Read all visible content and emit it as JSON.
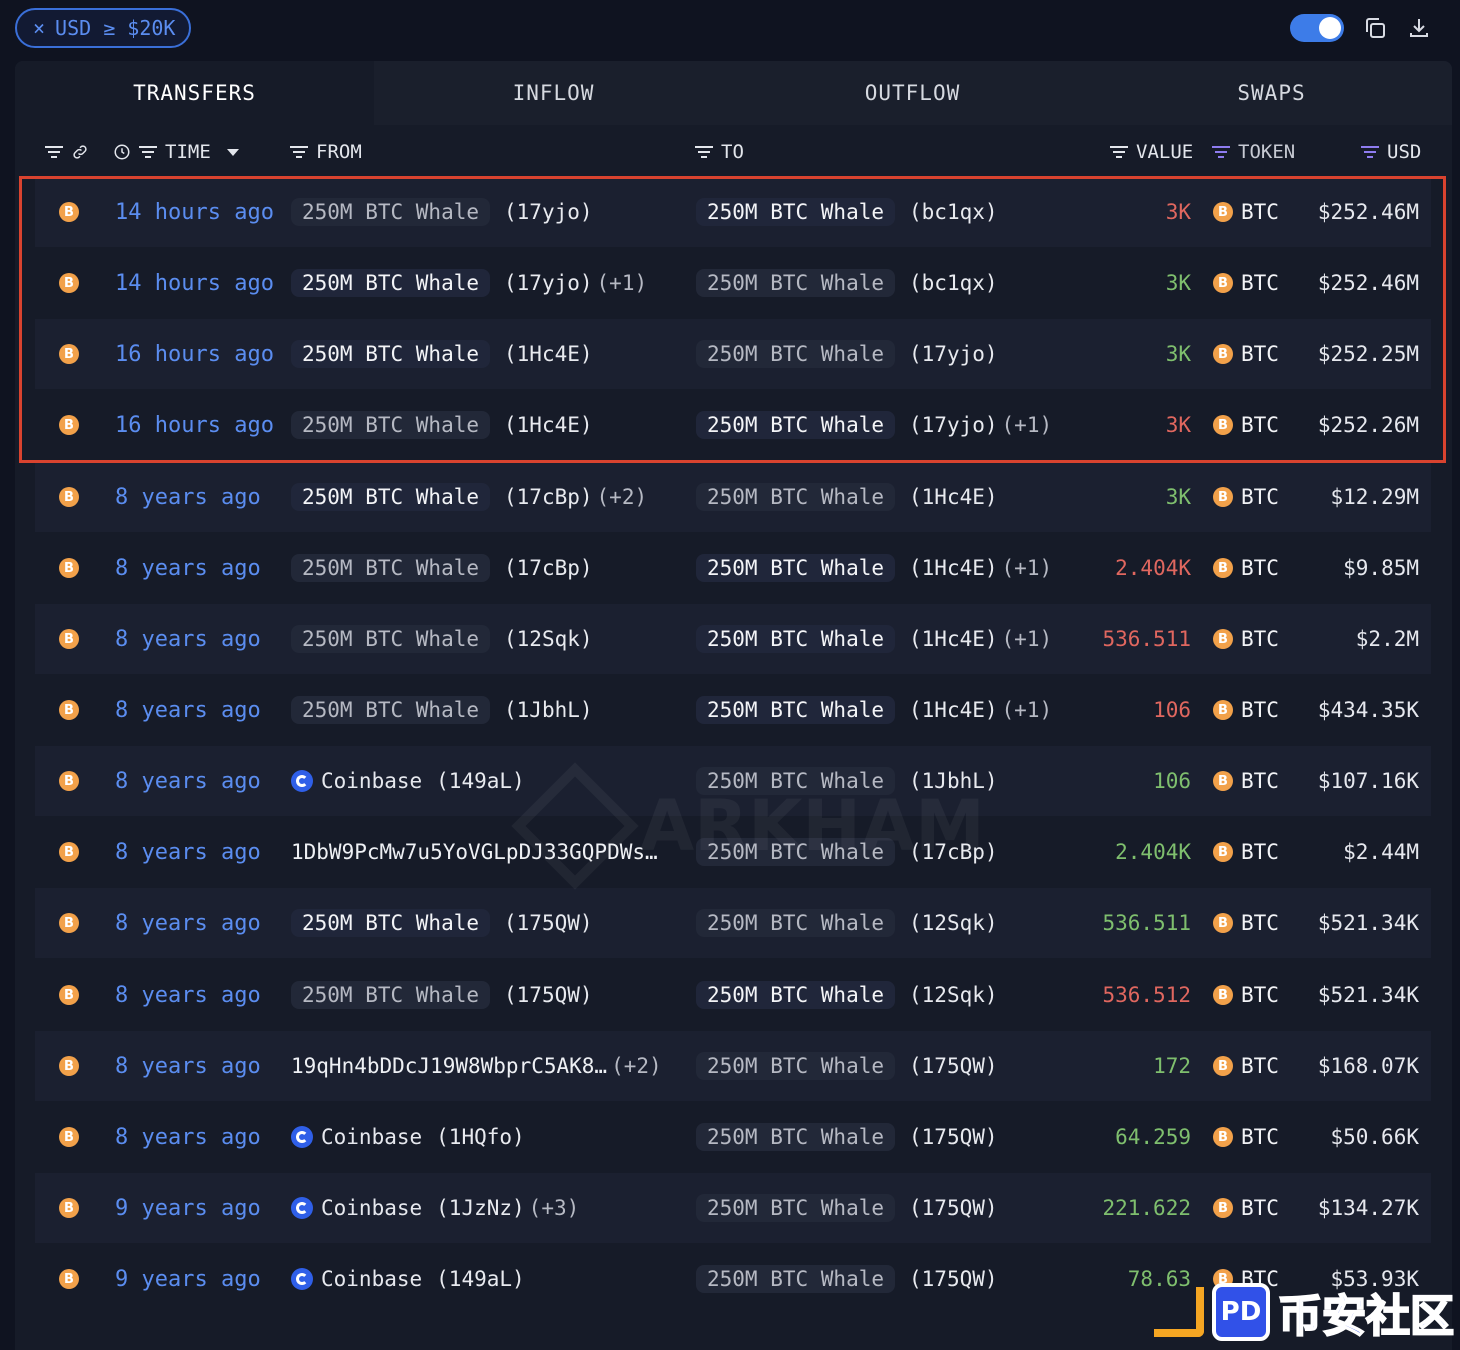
{
  "filter": {
    "close": "×",
    "label": "USD ≥ $20K"
  },
  "tabs": [
    "TRANSFERS",
    "INFLOW",
    "OUTFLOW",
    "SWAPS"
  ],
  "columns": {
    "time": "TIME",
    "from": "FROM",
    "to": "TO",
    "value": "VALUE",
    "token": "TOKEN",
    "usd": "USD"
  },
  "coin_glyph": "B",
  "rows": [
    {
      "time": "14 hours ago",
      "from": {
        "type": "entity",
        "name": "250M BTC Whale",
        "addr": "(17yjo)",
        "extra": "",
        "dim": true
      },
      "to": {
        "name": "250M BTC Whale",
        "addr": "(bc1qx)",
        "extra": "",
        "dim": false
      },
      "value": "3K",
      "value_color": "red",
      "token": "BTC",
      "usd": "$252.46M"
    },
    {
      "time": "14 hours ago",
      "from": {
        "type": "entity",
        "name": "250M BTC Whale",
        "addr": "(17yjo)",
        "extra": "(+1)",
        "dim": false
      },
      "to": {
        "name": "250M BTC Whale",
        "addr": "(bc1qx)",
        "extra": "",
        "dim": true
      },
      "value": "3K",
      "value_color": "green",
      "token": "BTC",
      "usd": "$252.46M"
    },
    {
      "time": "16 hours ago",
      "from": {
        "type": "entity",
        "name": "250M BTC Whale",
        "addr": "(1Hc4E)",
        "extra": "",
        "dim": false
      },
      "to": {
        "name": "250M BTC Whale",
        "addr": "(17yjo)",
        "extra": "",
        "dim": true
      },
      "value": "3K",
      "value_color": "green",
      "token": "BTC",
      "usd": "$252.25M"
    },
    {
      "time": "16 hours ago",
      "from": {
        "type": "entity",
        "name": "250M BTC Whale",
        "addr": "(1Hc4E)",
        "extra": "",
        "dim": true
      },
      "to": {
        "name": "250M BTC Whale",
        "addr": "(17yjo)",
        "extra": "(+1)",
        "dim": false
      },
      "value": "3K",
      "value_color": "red",
      "token": "BTC",
      "usd": "$252.26M"
    },
    {
      "time": "8 years ago",
      "from": {
        "type": "entity",
        "name": "250M BTC Whale",
        "addr": "(17cBp)",
        "extra": "(+2)",
        "dim": false
      },
      "to": {
        "name": "250M BTC Whale",
        "addr": "(1Hc4E)",
        "extra": "",
        "dim": true
      },
      "value": "3K",
      "value_color": "green",
      "token": "BTC",
      "usd": "$12.29M"
    },
    {
      "time": "8 years ago",
      "from": {
        "type": "entity",
        "name": "250M BTC Whale",
        "addr": "(17cBp)",
        "extra": "",
        "dim": true
      },
      "to": {
        "name": "250M BTC Whale",
        "addr": "(1Hc4E)",
        "extra": "(+1)",
        "dim": false
      },
      "value": "2.404K",
      "value_color": "red",
      "token": "BTC",
      "usd": "$9.85M"
    },
    {
      "time": "8 years ago",
      "from": {
        "type": "entity",
        "name": "250M BTC Whale",
        "addr": "(12Sqk)",
        "extra": "",
        "dim": true
      },
      "to": {
        "name": "250M BTC Whale",
        "addr": "(1Hc4E)",
        "extra": "(+1)",
        "dim": false
      },
      "value": "536.511",
      "value_color": "red",
      "token": "BTC",
      "usd": "$2.2M"
    },
    {
      "time": "8 years ago",
      "from": {
        "type": "entity",
        "name": "250M BTC Whale",
        "addr": "(1JbhL)",
        "extra": "",
        "dim": true
      },
      "to": {
        "name": "250M BTC Whale",
        "addr": "(1Hc4E)",
        "extra": "(+1)",
        "dim": false
      },
      "value": "106",
      "value_color": "red",
      "token": "BTC",
      "usd": "$434.35K"
    },
    {
      "time": "8 years ago",
      "from": {
        "type": "coinbase",
        "name": "Coinbase",
        "addr": "(149aL)",
        "extra": ""
      },
      "to": {
        "name": "250M BTC Whale",
        "addr": "(1JbhL)",
        "extra": "",
        "dim": true
      },
      "value": "106",
      "value_color": "green",
      "token": "BTC",
      "usd": "$107.16K"
    },
    {
      "time": "8 years ago",
      "from": {
        "type": "raw",
        "name": "1DbW9PcMw7u5YoVGLpDJ33GQPDWs…",
        "addr": "",
        "extra": ""
      },
      "to": {
        "name": "250M BTC Whale",
        "addr": "(17cBp)",
        "extra": "",
        "dim": true
      },
      "value": "2.404K",
      "value_color": "green",
      "token": "BTC",
      "usd": "$2.44M"
    },
    {
      "time": "8 years ago",
      "from": {
        "type": "entity",
        "name": "250M BTC Whale",
        "addr": "(175QW)",
        "extra": "",
        "dim": false
      },
      "to": {
        "name": "250M BTC Whale",
        "addr": "(12Sqk)",
        "extra": "",
        "dim": true
      },
      "value": "536.511",
      "value_color": "green",
      "token": "BTC",
      "usd": "$521.34K"
    },
    {
      "time": "8 years ago",
      "from": {
        "type": "entity",
        "name": "250M BTC Whale",
        "addr": "(175QW)",
        "extra": "",
        "dim": true
      },
      "to": {
        "name": "250M BTC Whale",
        "addr": "(12Sqk)",
        "extra": "",
        "dim": false
      },
      "value": "536.512",
      "value_color": "red",
      "token": "BTC",
      "usd": "$521.34K"
    },
    {
      "time": "8 years ago",
      "from": {
        "type": "raw",
        "name": "19qHn4bDDcJ19W8WbprC5AK8…",
        "addr": "",
        "extra": "(+2)"
      },
      "to": {
        "name": "250M BTC Whale",
        "addr": "(175QW)",
        "extra": "",
        "dim": true
      },
      "value": "172",
      "value_color": "green",
      "token": "BTC",
      "usd": "$168.07K"
    },
    {
      "time": "8 years ago",
      "from": {
        "type": "coinbase",
        "name": "Coinbase",
        "addr": "(1HQfo)",
        "extra": ""
      },
      "to": {
        "name": "250M BTC Whale",
        "addr": "(175QW)",
        "extra": "",
        "dim": true
      },
      "value": "64.259",
      "value_color": "green",
      "token": "BTC",
      "usd": "$50.66K"
    },
    {
      "time": "9 years ago",
      "from": {
        "type": "coinbase",
        "name": "Coinbase",
        "addr": "(1JzNz)",
        "extra": "(+3)"
      },
      "to": {
        "name": "250M BTC Whale",
        "addr": "(175QW)",
        "extra": "",
        "dim": true
      },
      "value": "221.622",
      "value_color": "green",
      "token": "BTC",
      "usd": "$134.27K"
    },
    {
      "time": "9 years ago",
      "from": {
        "type": "coinbase",
        "name": "Coinbase",
        "addr": "(149aL)",
        "extra": ""
      },
      "to": {
        "name": "250M BTC Whale",
        "addr": "(175QW)",
        "extra": "",
        "dim": true
      },
      "value": "78.63",
      "value_color": "green",
      "token": "BTC",
      "usd": "$53.93K"
    }
  ],
  "watermark": "ARKHAM",
  "badge": {
    "logo": "PD",
    "text": "币安社区"
  }
}
